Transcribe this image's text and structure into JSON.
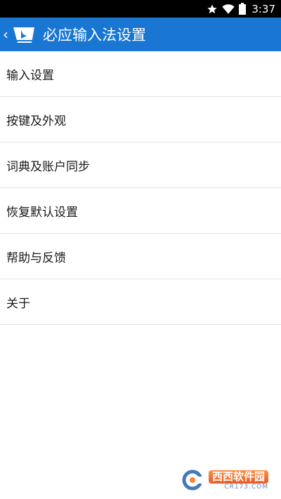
{
  "status_bar": {
    "time": "3:37",
    "icons": [
      "star-icon",
      "wifi-icon",
      "battery-icon"
    ]
  },
  "app_bar": {
    "title": "必应输入法设置",
    "icon": "bing-logo-icon",
    "back_icon": "chevron-left-icon",
    "background_color": "#1976d2"
  },
  "settings": {
    "items": [
      {
        "label": "输入设置"
      },
      {
        "label": "按键及外观"
      },
      {
        "label": "词典及账户同步"
      },
      {
        "label": "恢复默认设置"
      },
      {
        "label": "帮助与反馈"
      },
      {
        "label": "关于"
      }
    ]
  },
  "watermark": {
    "brand": "西西软件园",
    "domain": "CR173.COM"
  }
}
